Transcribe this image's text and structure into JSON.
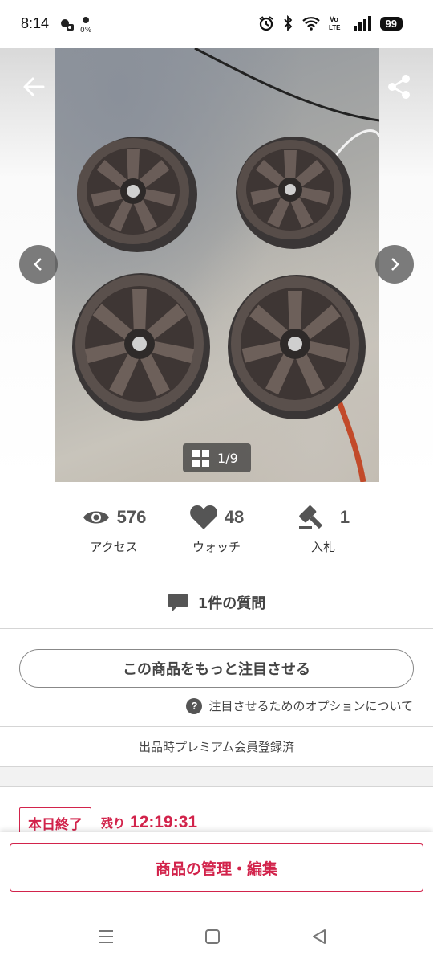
{
  "status_bar": {
    "time": "8:14",
    "battery": "99",
    "percent_small": "0%"
  },
  "gallery": {
    "counter": "1/9",
    "current": 1,
    "total": 9
  },
  "stats": {
    "access": {
      "value": "576",
      "label": "アクセス",
      "icon": "eye-icon"
    },
    "watch": {
      "value": "48",
      "label": "ウォッチ",
      "icon": "heart-icon"
    },
    "bids": {
      "value": "1",
      "label": "入札",
      "icon": "gavel-icon"
    }
  },
  "questions": {
    "label": "1件の質問",
    "icon": "chat-icon"
  },
  "promote": {
    "button_label": "この商品をもっと注目させる",
    "options_link": "注目させるためのオプションについて"
  },
  "premium_note": "出品時プレミアム会員登録済",
  "auction_end": {
    "badge": "本日終了",
    "remaining_label": "残り",
    "remaining_time": "12:19:31"
  },
  "bottom_action": {
    "label": "商品の管理・編集"
  },
  "colors": {
    "accent": "#d2234b",
    "text": "#444444",
    "divider": "#d5d5d5"
  }
}
